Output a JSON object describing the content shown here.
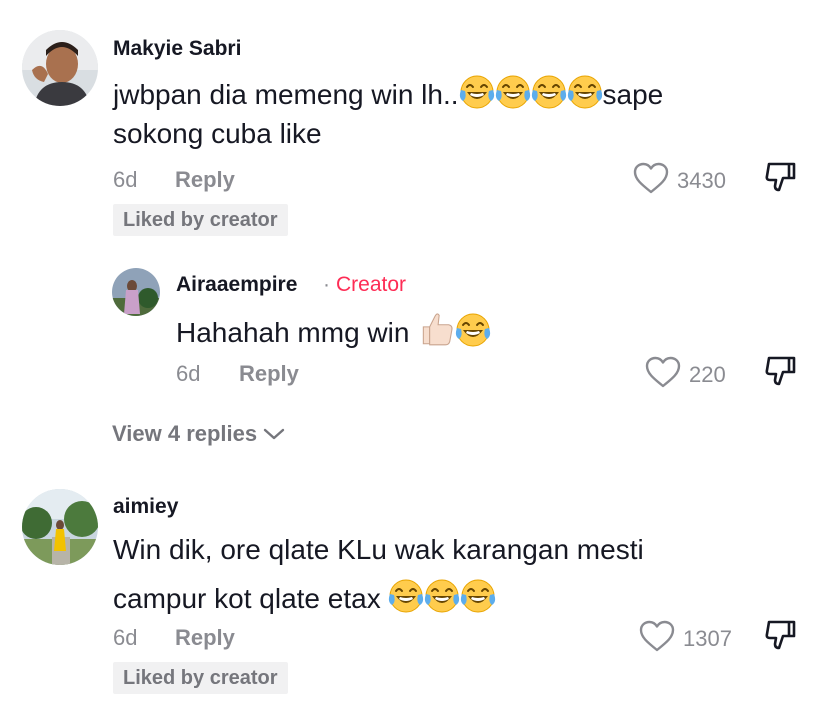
{
  "comments": [
    {
      "username": "Makyie Sabri",
      "text_line1_a": "jwbpan dia memeng win lh..",
      "text_line1_b": "sape",
      "text_line2": "sokong cuba like",
      "emojis": [
        "face-with-tears-of-joy",
        "face-with-tears-of-joy",
        "face-with-tears-of-joy",
        "face-with-tears-of-joy"
      ],
      "time": "6d",
      "reply_label": "Reply",
      "likes": "3430",
      "badge": "Liked by creator",
      "replies": [
        {
          "username": "Airaaempire",
          "creator_label": "Creator",
          "text": "Hahahah mmg win",
          "emojis": [
            "thumbs-up-light-skin",
            "face-with-tears-of-joy"
          ],
          "time": "6d",
          "reply_label": "Reply",
          "likes": "220"
        }
      ],
      "view_replies_label": "View 4 replies"
    },
    {
      "username": "aimiey",
      "text_line1": "Win dik, ore qlate KLu wak karangan mesti",
      "text_line2": "campur kot qlate etax",
      "emojis": [
        "face-with-tears-of-joy",
        "face-with-tears-of-joy",
        "face-with-tears-of-joy"
      ],
      "time": "6d",
      "reply_label": "Reply",
      "likes": "1307",
      "badge": "Liked by creator"
    }
  ],
  "icons": {
    "like": "heart-outline-icon",
    "dislike": "thumbs-down-outline-icon",
    "expand": "chevron-down-icon"
  },
  "colors": {
    "text": "#161823",
    "muted": "#8a8b91",
    "creator": "#fe2c55",
    "badge_bg": "#f1f1f2"
  }
}
